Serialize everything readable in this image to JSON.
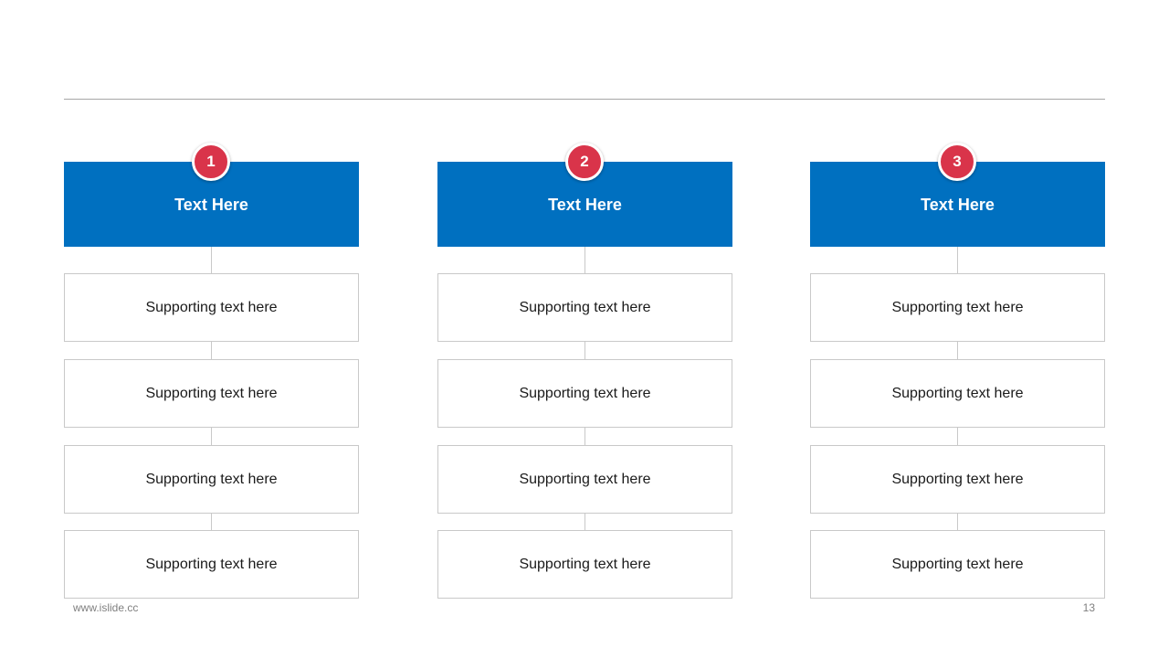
{
  "colors": {
    "header_blue": "#0070c0",
    "badge_red": "#d9344a",
    "box_border": "#c9c9c9",
    "rule_gray": "#a6a6a6"
  },
  "columns": [
    {
      "number": "1",
      "title": "Text Here",
      "items": [
        "Supporting text here",
        "Supporting text here",
        "Supporting text here",
        "Supporting text here"
      ]
    },
    {
      "number": "2",
      "title": "Text Here",
      "items": [
        "Supporting text here",
        "Supporting text here",
        "Supporting text here",
        "Supporting text here"
      ]
    },
    {
      "number": "3",
      "title": "Text Here",
      "items": [
        "Supporting text here",
        "Supporting text here",
        "Supporting text here",
        "Supporting text here"
      ]
    }
  ],
  "footer": {
    "website": "www.islide.cc",
    "page_number": "13"
  }
}
